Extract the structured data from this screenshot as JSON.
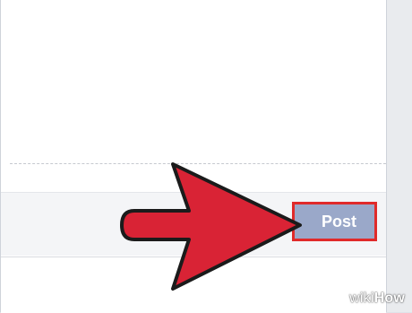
{
  "post_button": {
    "label": "Post"
  },
  "watermark": {
    "wiki": "wiki",
    "how": "How"
  },
  "colors": {
    "arrow_fill": "#d92335",
    "arrow_outline": "#1b1b1b",
    "highlight_border": "#e02a2a",
    "post_button_bg": "#9aa8c9"
  },
  "icons": {
    "pointer": "arrow-right-icon"
  }
}
